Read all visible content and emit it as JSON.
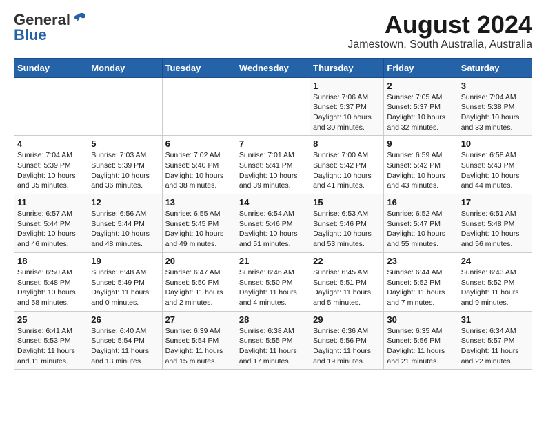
{
  "logo": {
    "general": "General",
    "blue": "Blue"
  },
  "title": "August 2024",
  "subtitle": "Jamestown, South Australia, Australia",
  "days_of_week": [
    "Sunday",
    "Monday",
    "Tuesday",
    "Wednesday",
    "Thursday",
    "Friday",
    "Saturday"
  ],
  "weeks": [
    [
      {
        "num": "",
        "content": ""
      },
      {
        "num": "",
        "content": ""
      },
      {
        "num": "",
        "content": ""
      },
      {
        "num": "",
        "content": ""
      },
      {
        "num": "1",
        "content": "Sunrise: 7:06 AM\nSunset: 5:37 PM\nDaylight: 10 hours\nand 30 minutes."
      },
      {
        "num": "2",
        "content": "Sunrise: 7:05 AM\nSunset: 5:37 PM\nDaylight: 10 hours\nand 32 minutes."
      },
      {
        "num": "3",
        "content": "Sunrise: 7:04 AM\nSunset: 5:38 PM\nDaylight: 10 hours\nand 33 minutes."
      }
    ],
    [
      {
        "num": "4",
        "content": "Sunrise: 7:04 AM\nSunset: 5:39 PM\nDaylight: 10 hours\nand 35 minutes."
      },
      {
        "num": "5",
        "content": "Sunrise: 7:03 AM\nSunset: 5:39 PM\nDaylight: 10 hours\nand 36 minutes."
      },
      {
        "num": "6",
        "content": "Sunrise: 7:02 AM\nSunset: 5:40 PM\nDaylight: 10 hours\nand 38 minutes."
      },
      {
        "num": "7",
        "content": "Sunrise: 7:01 AM\nSunset: 5:41 PM\nDaylight: 10 hours\nand 39 minutes."
      },
      {
        "num": "8",
        "content": "Sunrise: 7:00 AM\nSunset: 5:42 PM\nDaylight: 10 hours\nand 41 minutes."
      },
      {
        "num": "9",
        "content": "Sunrise: 6:59 AM\nSunset: 5:42 PM\nDaylight: 10 hours\nand 43 minutes."
      },
      {
        "num": "10",
        "content": "Sunrise: 6:58 AM\nSunset: 5:43 PM\nDaylight: 10 hours\nand 44 minutes."
      }
    ],
    [
      {
        "num": "11",
        "content": "Sunrise: 6:57 AM\nSunset: 5:44 PM\nDaylight: 10 hours\nand 46 minutes."
      },
      {
        "num": "12",
        "content": "Sunrise: 6:56 AM\nSunset: 5:44 PM\nDaylight: 10 hours\nand 48 minutes."
      },
      {
        "num": "13",
        "content": "Sunrise: 6:55 AM\nSunset: 5:45 PM\nDaylight: 10 hours\nand 49 minutes."
      },
      {
        "num": "14",
        "content": "Sunrise: 6:54 AM\nSunset: 5:46 PM\nDaylight: 10 hours\nand 51 minutes."
      },
      {
        "num": "15",
        "content": "Sunrise: 6:53 AM\nSunset: 5:46 PM\nDaylight: 10 hours\nand 53 minutes."
      },
      {
        "num": "16",
        "content": "Sunrise: 6:52 AM\nSunset: 5:47 PM\nDaylight: 10 hours\nand 55 minutes."
      },
      {
        "num": "17",
        "content": "Sunrise: 6:51 AM\nSunset: 5:48 PM\nDaylight: 10 hours\nand 56 minutes."
      }
    ],
    [
      {
        "num": "18",
        "content": "Sunrise: 6:50 AM\nSunset: 5:48 PM\nDaylight: 10 hours\nand 58 minutes."
      },
      {
        "num": "19",
        "content": "Sunrise: 6:48 AM\nSunset: 5:49 PM\nDaylight: 11 hours\nand 0 minutes."
      },
      {
        "num": "20",
        "content": "Sunrise: 6:47 AM\nSunset: 5:50 PM\nDaylight: 11 hours\nand 2 minutes."
      },
      {
        "num": "21",
        "content": "Sunrise: 6:46 AM\nSunset: 5:50 PM\nDaylight: 11 hours\nand 4 minutes."
      },
      {
        "num": "22",
        "content": "Sunrise: 6:45 AM\nSunset: 5:51 PM\nDaylight: 11 hours\nand 5 minutes."
      },
      {
        "num": "23",
        "content": "Sunrise: 6:44 AM\nSunset: 5:52 PM\nDaylight: 11 hours\nand 7 minutes."
      },
      {
        "num": "24",
        "content": "Sunrise: 6:43 AM\nSunset: 5:52 PM\nDaylight: 11 hours\nand 9 minutes."
      }
    ],
    [
      {
        "num": "25",
        "content": "Sunrise: 6:41 AM\nSunset: 5:53 PM\nDaylight: 11 hours\nand 11 minutes."
      },
      {
        "num": "26",
        "content": "Sunrise: 6:40 AM\nSunset: 5:54 PM\nDaylight: 11 hours\nand 13 minutes."
      },
      {
        "num": "27",
        "content": "Sunrise: 6:39 AM\nSunset: 5:54 PM\nDaylight: 11 hours\nand 15 minutes."
      },
      {
        "num": "28",
        "content": "Sunrise: 6:38 AM\nSunset: 5:55 PM\nDaylight: 11 hours\nand 17 minutes."
      },
      {
        "num": "29",
        "content": "Sunrise: 6:36 AM\nSunset: 5:56 PM\nDaylight: 11 hours\nand 19 minutes."
      },
      {
        "num": "30",
        "content": "Sunrise: 6:35 AM\nSunset: 5:56 PM\nDaylight: 11 hours\nand 21 minutes."
      },
      {
        "num": "31",
        "content": "Sunrise: 6:34 AM\nSunset: 5:57 PM\nDaylight: 11 hours\nand 22 minutes."
      }
    ]
  ]
}
